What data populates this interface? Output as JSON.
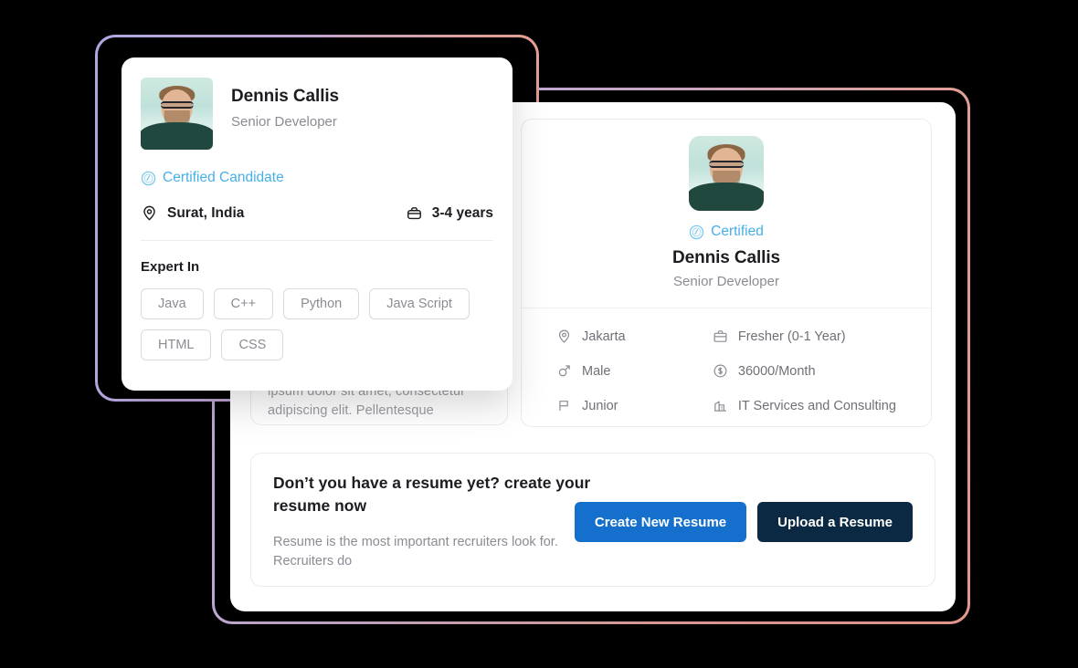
{
  "theme": {
    "background": "#000000",
    "panel_bg": "#ffffff",
    "accent_blue": "#46b0e8",
    "primary_button": "#1570cd",
    "dark_button": "#0b2942",
    "text_primary": "#1c1d21",
    "text_muted": "#8b8c93",
    "frame_gradient_start": "#b0a7e2",
    "frame_gradient_end": "#e59b90"
  },
  "front_card": {
    "name": "Dennis Callis",
    "role": "Senior Developer",
    "certified_label": "Certified Candidate",
    "certified_icon": "certified-badge-icon",
    "location_icon": "location-pin-icon",
    "location": "Surat, India",
    "experience_icon": "briefcase-icon",
    "experience": "3-4 years",
    "expert_in_label": "Expert In",
    "skills": [
      "Java",
      "C++",
      "Python",
      "Java Script",
      "HTML",
      "CSS"
    ],
    "photo_alt": "candidate-photo"
  },
  "description_card": {
    "text": "ipsum dolor sit amet, consectetur adipiscing elit. Pellentesque"
  },
  "profile_card": {
    "photo_alt": "candidate-photo",
    "certified_label": "Certified",
    "certified_icon": "certified-badge-icon",
    "name": "Dennis Callis",
    "role": "Senior Developer",
    "details": [
      {
        "icon": "location-pin-icon",
        "value": "Jakarta"
      },
      {
        "icon": "briefcase-icon",
        "value": "Fresher (0-1 Year)"
      },
      {
        "icon": "male-gender-icon",
        "value": "Male"
      },
      {
        "icon": "dollar-circle-icon",
        "value": "36000/Month"
      },
      {
        "icon": "flag-icon",
        "value": "Junior"
      },
      {
        "icon": "building-icon",
        "value": "IT Services and Consulting"
      }
    ]
  },
  "resume_card": {
    "title": "Don’t you have a resume yet? create your resume now",
    "subtitle": "Resume is the most important recruiters look for. Recruiters do",
    "create_button": "Create New Resume",
    "upload_button": "Upload a Resume"
  }
}
